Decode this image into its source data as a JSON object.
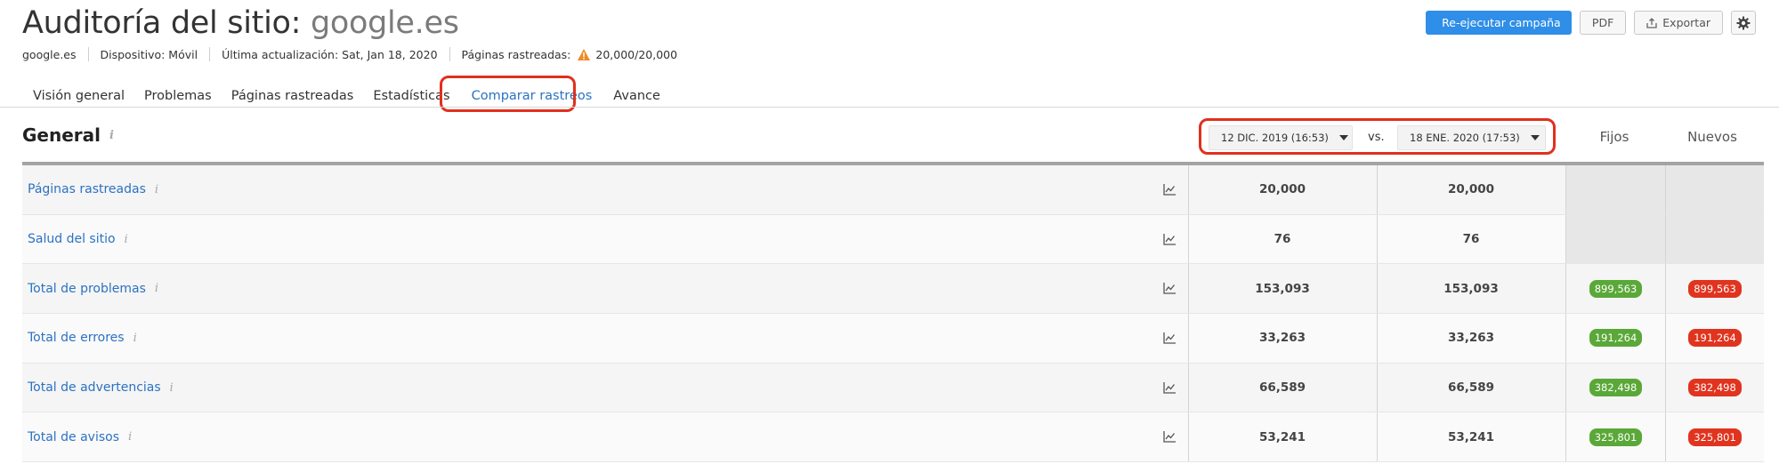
{
  "header": {
    "title_prefix": "Auditoría del sitio: ",
    "title_domain": "google.es",
    "meta": {
      "domain": "google.es",
      "device": "Dispositivo: Móvil",
      "last_update": "Última actualización: Sat, Jan 18, 2020",
      "pages_crawled_label": "Páginas rastreadas:",
      "pages_crawled_value": "20,000/20,000"
    }
  },
  "actions": {
    "rerun": "Re-ejecutar campaña",
    "pdf": "PDF",
    "export": "Exportar"
  },
  "tabs": [
    {
      "label": "Visión general"
    },
    {
      "label": "Problemas"
    },
    {
      "label": "Páginas rastreadas"
    },
    {
      "label": "Estadísticas"
    },
    {
      "label": "Comparar rastreos"
    },
    {
      "label": "Avance"
    }
  ],
  "active_tab": "Comparar rastreos",
  "section": {
    "title": "General",
    "info_glyph": "i"
  },
  "compare": {
    "date_a": "12 DIC. 2019 (16:53)",
    "vs": "vs.",
    "date_b": "18 ENE. 2020 (17:53)"
  },
  "columns": {
    "fixed": "Fijos",
    "new": "Nuevos"
  },
  "colors": {
    "accent": "#2f8ee7",
    "link": "#2b72c2",
    "highlight": "#e0301e",
    "fixed_badge": "#5aa838",
    "new_badge": "#e0341f"
  },
  "rows": [
    {
      "label": "Páginas rastreadas",
      "a": "20,000",
      "b": "20,000",
      "fixed": "",
      "new": ""
    },
    {
      "label": "Salud del sitio",
      "a": "76",
      "b": "76",
      "fixed": "",
      "new": ""
    },
    {
      "label": "Total de problemas",
      "a": "153,093",
      "b": "153,093",
      "fixed": "899,563",
      "new": "899,563"
    },
    {
      "label": "Total de errores",
      "a": "33,263",
      "b": "33,263",
      "fixed": "191,264",
      "new": "191,264"
    },
    {
      "label": "Total de advertencias",
      "a": "66,589",
      "b": "66,589",
      "fixed": "382,498",
      "new": "382,498"
    },
    {
      "label": "Total de avisos",
      "a": "53,241",
      "b": "53,241",
      "fixed": "325,801",
      "new": "325,801"
    }
  ]
}
